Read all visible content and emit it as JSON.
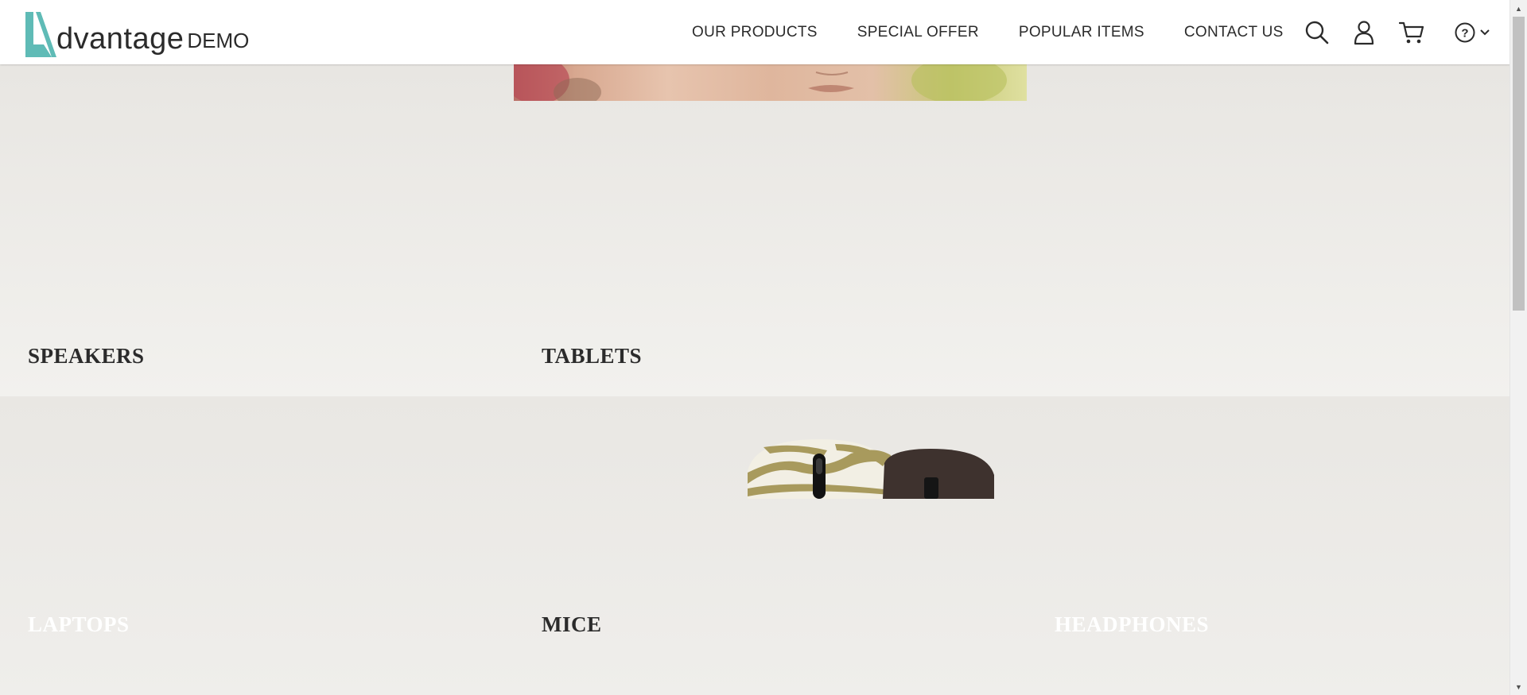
{
  "header": {
    "logo": {
      "brand": "dvantage",
      "demo": "DEMO"
    },
    "nav": [
      {
        "label": "OUR PRODUCTS"
      },
      {
        "label": "SPECIAL OFFER"
      },
      {
        "label": "POPULAR ITEMS"
      },
      {
        "label": "CONTACT US"
      }
    ],
    "icons": [
      "search-icon",
      "user-icon",
      "cart-icon",
      "help-icon",
      "chevron-down-icon"
    ]
  },
  "categories": {
    "speakers": "SPEAKERS",
    "tablets": "TABLETS",
    "laptops": "LAPTOPS",
    "mice": "MICE",
    "headphones": "HEADPHONES"
  },
  "colors": {
    "accent": "#5fbbb6",
    "text": "#2b2b2b",
    "band": "#ecebe7"
  }
}
